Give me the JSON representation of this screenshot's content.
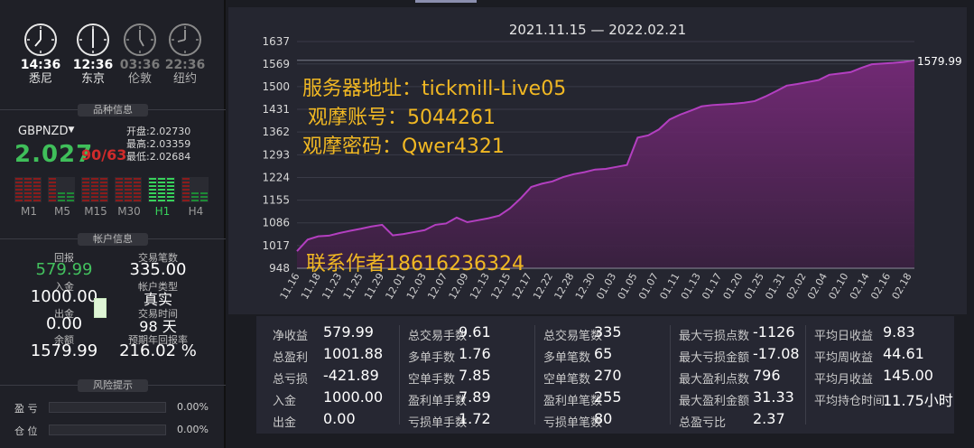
{
  "clocks": [
    {
      "time": "14:36",
      "city": "悉尼",
      "active": true
    },
    {
      "time": "12:36",
      "city": "东京",
      "active": true
    },
    {
      "time": "03:36",
      "city": "伦敦",
      "active": false
    },
    {
      "time": "22:36",
      "city": "纽约",
      "active": false
    }
  ],
  "sections": {
    "symbol_info": "品种信息",
    "account_info": "帐户信息",
    "risk": "风险提示"
  },
  "symbol": {
    "name": "GBPNZD",
    "price_main": "2.027",
    "price_digits": "90/63",
    "open_label": "开盘:",
    "open": "2.02730",
    "high_label": "最高:",
    "high": "2.03359",
    "low_label": "最低:",
    "low": "2.02684"
  },
  "timeframes": [
    {
      "label": "M1",
      "color": "red"
    },
    {
      "label": "M5",
      "color": "mixed"
    },
    {
      "label": "M15",
      "color": "red"
    },
    {
      "label": "M30",
      "color": "red"
    },
    {
      "label": "H1",
      "color": "green"
    },
    {
      "label": "H4",
      "color": "mixed"
    }
  ],
  "account": {
    "return_label": "回报",
    "return_value": "579.99",
    "trades_label": "交易笔数",
    "trades_value": "335.00",
    "deposit_label": "入金",
    "deposit_value": "1000.00",
    "type_label": "帐户类型",
    "type_value": "真实",
    "withdraw_label": "出金",
    "withdraw_value": "0.00",
    "time_label": "交易时间",
    "time_value": "98 天",
    "balance_label": "余额",
    "balance_value": "1579.99",
    "annual_label": "预期年回报率",
    "annual_value": "216.02 %"
  },
  "risk": [
    {
      "label": "盈 亏",
      "pct": "0.00%"
    },
    {
      "label": "仓 位",
      "pct": "0.00%"
    }
  ],
  "overlay": {
    "server": "服务器地址：tickmill-Live05",
    "account": "观摩账号：5044261",
    "password": "观摩密码：Qwer4321",
    "contact": "联系作者18616236324"
  },
  "chart_data": {
    "type": "area",
    "title": "2021.11.15 — 2022.02.21",
    "last_label": "1579.99",
    "ylim": [
      948,
      1637
    ],
    "yticks": [
      948,
      1017,
      1086,
      1155,
      1224,
      1293,
      1362,
      1431,
      1500,
      1569,
      1637
    ],
    "xticks": [
      "11.16",
      "11.18",
      "11.23",
      "11.25",
      "11.29",
      "12.01",
      "12.03",
      "12.07",
      "12.09",
      "12.13",
      "12.15",
      "12.17",
      "12.22",
      "12.28",
      "12.30",
      "01.03",
      "01.05",
      "01.07",
      "01.11",
      "01.13",
      "01.17",
      "01.20",
      "01.25",
      "01.31",
      "02.02",
      "02.04",
      "02.10",
      "02.14",
      "02.16",
      "02.18"
    ],
    "x": [
      0,
      1,
      2,
      3,
      4,
      5,
      6,
      7,
      8,
      9,
      10,
      11,
      12,
      13,
      14,
      15,
      16,
      17,
      18,
      19,
      20,
      21,
      22,
      23,
      24,
      25,
      26,
      27,
      28,
      29,
      30,
      31,
      32,
      33,
      34,
      35,
      36,
      37,
      38,
      39,
      40,
      41,
      42,
      43,
      44,
      45,
      46,
      47,
      48,
      49,
      50,
      51,
      52,
      53,
      54,
      55,
      56,
      57,
      58
    ],
    "y": [
      1000,
      1035,
      1045,
      1047,
      1055,
      1062,
      1068,
      1075,
      1080,
      1048,
      1052,
      1058,
      1064,
      1080,
      1084,
      1102,
      1088,
      1094,
      1100,
      1108,
      1130,
      1160,
      1195,
      1205,
      1212,
      1225,
      1234,
      1240,
      1248,
      1250,
      1256,
      1262,
      1345,
      1352,
      1370,
      1400,
      1415,
      1427,
      1440,
      1444,
      1446,
      1448,
      1451,
      1456,
      1470,
      1486,
      1503,
      1508,
      1514,
      1520,
      1536,
      1540,
      1544,
      1557,
      1568,
      1570,
      1572,
      1575,
      1579.99
    ]
  },
  "stats": [
    [
      {
        "k": "净收益",
        "v": "579.99"
      },
      {
        "k": "总盈利",
        "v": "1001.88"
      },
      {
        "k": "总亏损",
        "v": "-421.89"
      },
      {
        "k": "入金",
        "v": "1000.00"
      },
      {
        "k": "出金",
        "v": "0.00"
      }
    ],
    [
      {
        "k": "总交易手数",
        "v": "9.61"
      },
      {
        "k": "多单手数",
        "v": "1.76"
      },
      {
        "k": "空单手数",
        "v": "7.85"
      },
      {
        "k": "盈利单手数",
        "v": "7.89"
      },
      {
        "k": "亏损单手数",
        "v": "1.72"
      }
    ],
    [
      {
        "k": "总交易笔数",
        "v": "335"
      },
      {
        "k": "多单笔数",
        "v": "65"
      },
      {
        "k": "空单笔数",
        "v": "270"
      },
      {
        "k": "盈利单笔数",
        "v": "255"
      },
      {
        "k": "亏损单笔数",
        "v": "80"
      }
    ],
    [
      {
        "k": "最大亏损点数",
        "v": "-1126"
      },
      {
        "k": "最大亏损金额",
        "v": "-17.08"
      },
      {
        "k": "最大盈利点数",
        "v": "796"
      },
      {
        "k": "最大盈利金额",
        "v": "31.33"
      },
      {
        "k": "总盈亏比",
        "v": "2.37"
      }
    ],
    [
      {
        "k": "平均日收益",
        "v": "9.83"
      },
      {
        "k": "平均周收益",
        "v": "44.61"
      },
      {
        "k": "平均月收益",
        "v": "145.00"
      },
      {
        "k": "平均持仓时间",
        "v": "11.75小时"
      }
    ]
  ]
}
